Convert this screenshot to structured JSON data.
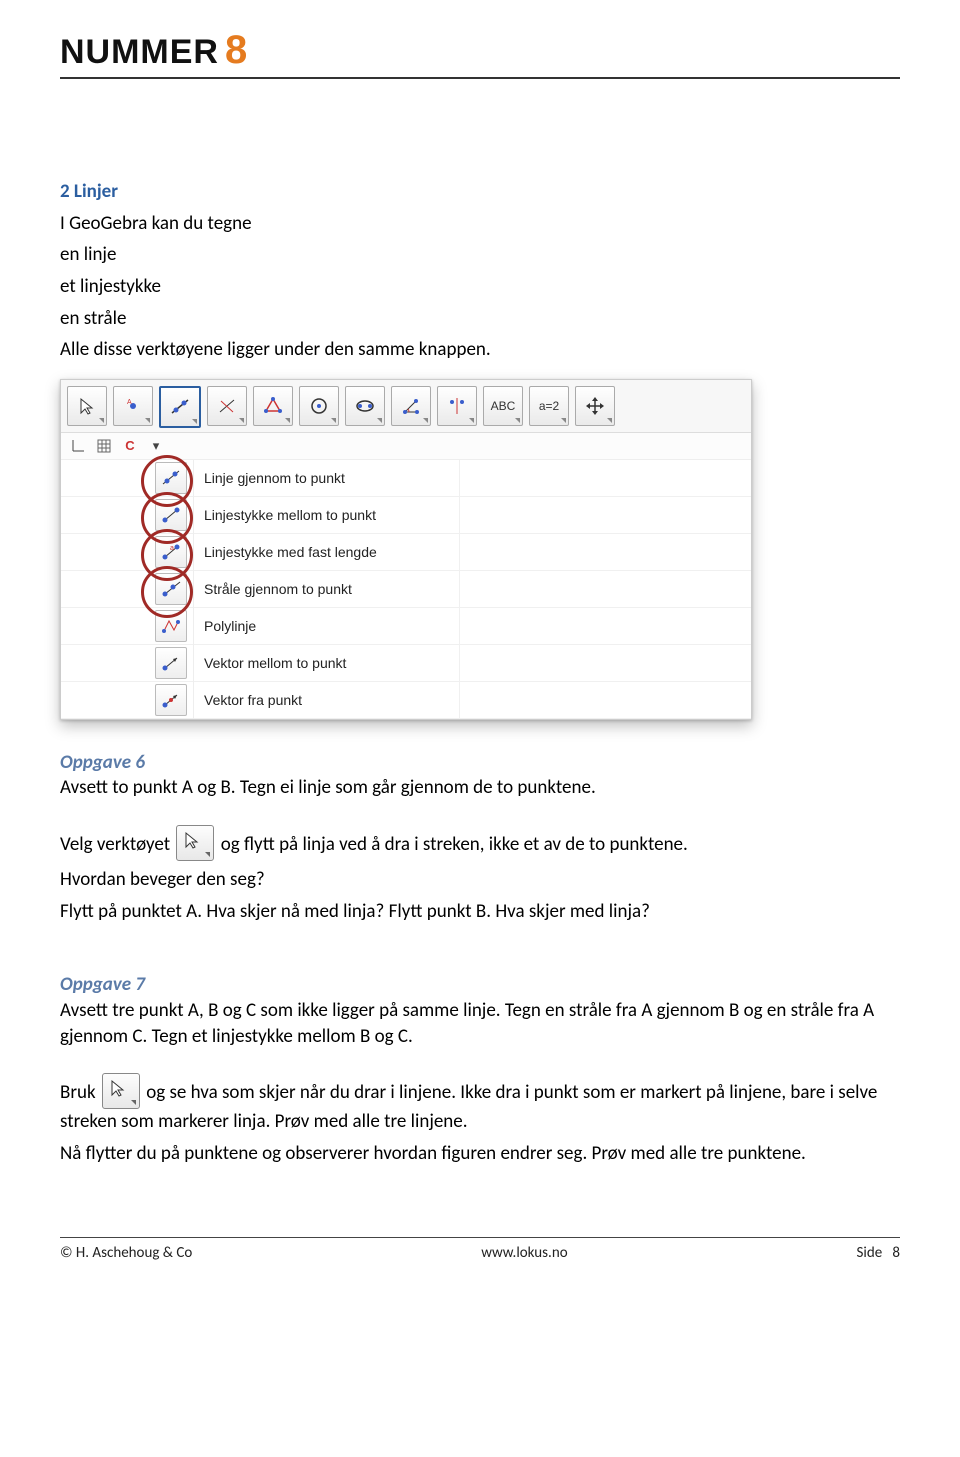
{
  "header": {
    "logo_word": "NUMMER",
    "logo_num": "8"
  },
  "section": {
    "title": "2 Linjer",
    "intro1": "I GeoGebra kan du tegne",
    "bullets": [
      "en linje",
      "et linjestykke",
      "en stråle"
    ],
    "intro2": "Alle disse verktøyene ligger under den samme knappen."
  },
  "screenshot": {
    "toolbar_labels": [
      "ABC",
      "a=2"
    ],
    "menu_items": [
      "Linje gjennom to punkt",
      "Linjestykke mellom to punkt",
      "Linjestykke med fast lengde",
      "Stråle gjennom to punkt",
      "Polylinje",
      "Vektor mellom to punkt",
      "Vektor fra punkt"
    ],
    "circled_indices": [
      0,
      1,
      2,
      3
    ]
  },
  "opp6": {
    "title": "Oppgave 6",
    "line1": "Avsett to punkt A og B. Tegn ei linje som går gjennom de to punktene.",
    "line2_pre": "Velg verktøyet",
    "line2_post": "og flytt på linja ved å dra i streken, ikke et av de to punktene.",
    "line3": "Hvordan beveger den seg?",
    "line4": "Flytt på punktet A. Hva skjer nå med linja? Flytt punkt B. Hva skjer med linja?"
  },
  "opp7": {
    "title": "Oppgave 7",
    "para1": "Avsett tre punkt A, B og C som ikke ligger på samme linje. Tegn en stråle fra A gjennom B og en stråle fra A gjennom C. Tegn et linjestykke mellom B og C.",
    "line2_pre": "Bruk",
    "line2_post": "og se hva som skjer når du drar i linjene. Ikke dra i punkt som er markert på linjene, bare i selve streken som markerer linja. Prøv med alle tre linjene.",
    "para3": "Nå flytter du på punktene og observerer hvordan figuren endrer seg. Prøv med alle tre punktene."
  },
  "footer": {
    "left": "© H. Aschehoug & Co",
    "center": "www.lokus.no",
    "right_label": "Side",
    "right_num": "8"
  }
}
